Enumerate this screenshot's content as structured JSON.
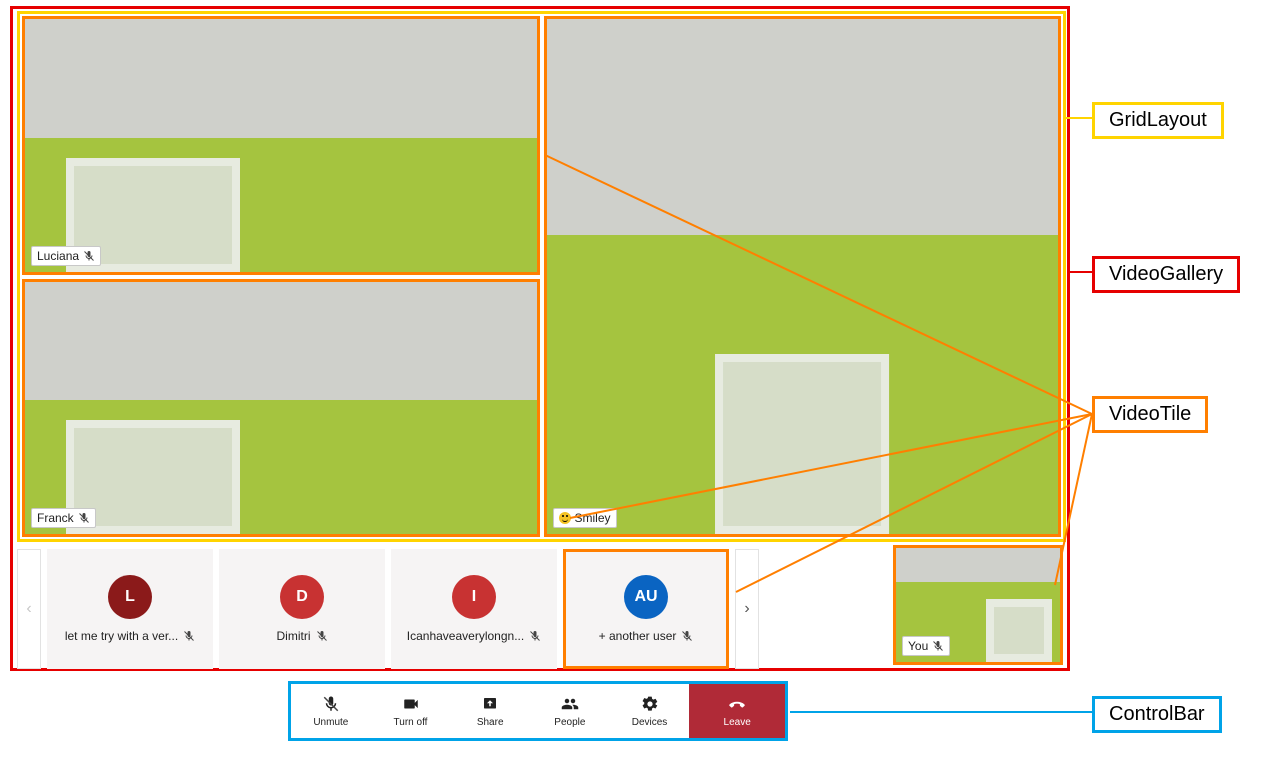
{
  "annotations": {
    "grid_layout": "GridLayout",
    "video_gallery": "VideoGallery",
    "video_tile": "VideoTile",
    "control_bar": "ControlBar"
  },
  "tiles": {
    "luciana": "Luciana",
    "franck": "Franck",
    "smiley": "Smiley"
  },
  "strip": {
    "items": [
      {
        "initial": "L",
        "label": "let me try with a ver...",
        "muted": true,
        "color": "maroon"
      },
      {
        "initial": "D",
        "label": "Dimitri",
        "muted": true,
        "color": "red"
      },
      {
        "initial": "I",
        "label": "Icanhaveaverylongn...",
        "muted": true,
        "color": "red"
      },
      {
        "initial": "AU",
        "label": "+ another user",
        "muted": true,
        "color": "blue"
      }
    ]
  },
  "self_tile": {
    "label": "You",
    "muted": true
  },
  "controls": {
    "unmute": "Unmute",
    "turnoff": "Turn off",
    "share": "Share",
    "people": "People",
    "devices": "Devices",
    "leave": "Leave"
  }
}
